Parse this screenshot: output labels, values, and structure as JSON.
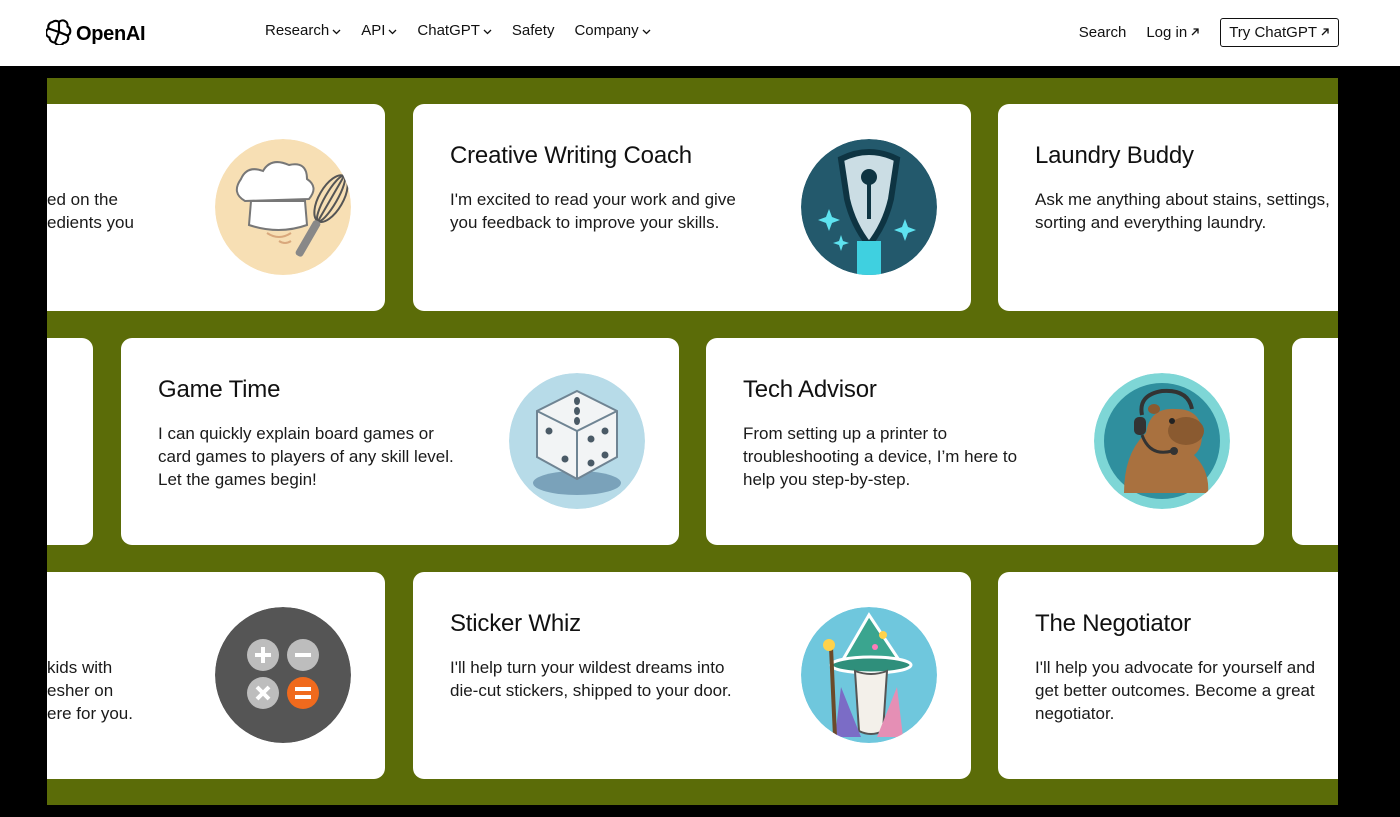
{
  "header": {
    "logo_text": "OpenAI",
    "nav": [
      {
        "label": "Research",
        "has_dropdown": true
      },
      {
        "label": "API",
        "has_dropdown": true
      },
      {
        "label": "ChatGPT",
        "has_dropdown": true
      },
      {
        "label": "Safety",
        "has_dropdown": false
      },
      {
        "label": "Company",
        "has_dropdown": true
      }
    ],
    "search_label": "Search",
    "login_label": "Log in",
    "try_label": "Try ChatGPT"
  },
  "colors": {
    "stage_background": "#5b6c08",
    "card_background": "#ffffff",
    "page_background": "#000000"
  },
  "cards": {
    "row1": {
      "partial_left": {
        "desc_lines": [
          "ed on the",
          "edients you"
        ],
        "icon": "chef-hat-whisk-icon"
      },
      "creative": {
        "title": "Creative Writing Coach",
        "desc": "I'm excited to read your work and give you feedback to improve your skills.",
        "icon": "fountain-pen-icon"
      },
      "laundry": {
        "title": "Laundry Buddy",
        "desc": "Ask me anything about stains, settings, sorting and everything laundry."
      }
    },
    "row2": {
      "game": {
        "title": "Game Time",
        "desc": "I can quickly explain board games or card games to players of any skill level. Let the games begin!",
        "icon": "dice-icon"
      },
      "tech": {
        "title": "Tech Advisor",
        "desc": "From setting up a printer to troubleshooting a device, I’m here to help you step-by-step.",
        "icon": "capybara-headset-icon"
      }
    },
    "row3": {
      "partial_left": {
        "desc_lines": [
          "kids with",
          "esher on",
          "ere for you."
        ],
        "icon": "calculator-icon"
      },
      "sticker": {
        "title": "Sticker Whiz",
        "desc": "I'll help turn your wildest dreams into die-cut stickers, shipped to your door.",
        "icon": "wizard-icon"
      },
      "negotiator": {
        "title": "The Negotiator",
        "desc": "I'll help you advocate for yourself and get better outcomes. Become a great negotiator."
      }
    }
  }
}
